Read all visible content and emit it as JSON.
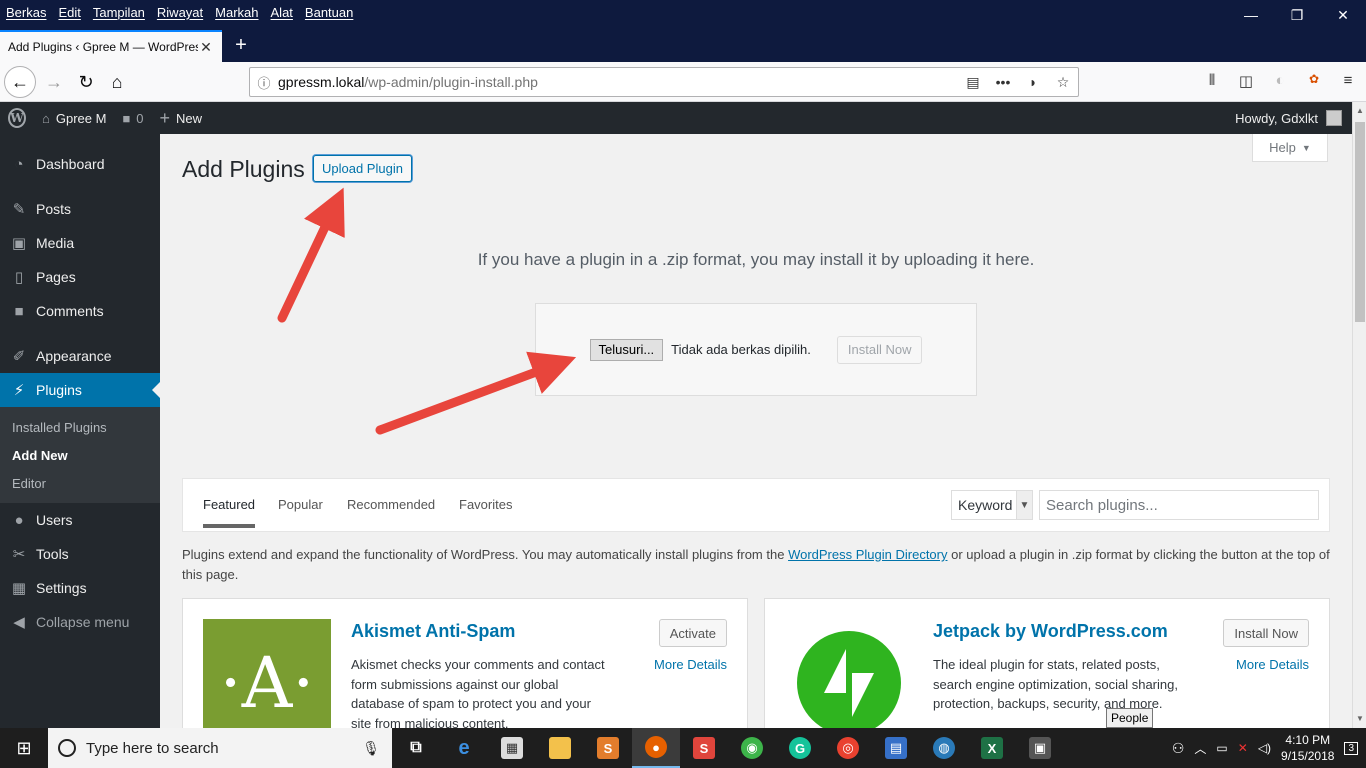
{
  "browser": {
    "menu": [
      "Berkas",
      "Edit",
      "Tampilan",
      "Riwayat",
      "Markah",
      "Alat",
      "Bantuan"
    ],
    "tab_title": "Add Plugins ‹ Gpree M — WordPres",
    "url_host": "gpressm.lokal",
    "url_path": "/wp-admin/plugin-install.php"
  },
  "adminbar": {
    "site_name": "Gpree M",
    "comments_count": "0",
    "new_label": "New",
    "howdy": "Howdy, Gdxlkt"
  },
  "sidebar": {
    "items": [
      {
        "label": "Dashboard",
        "icon": "dashboard-icon"
      },
      {
        "label": "Posts",
        "icon": "pin-icon"
      },
      {
        "label": "Media",
        "icon": "media-icon"
      },
      {
        "label": "Pages",
        "icon": "pages-icon"
      },
      {
        "label": "Comments",
        "icon": "comment-icon"
      },
      {
        "label": "Appearance",
        "icon": "brush-icon"
      },
      {
        "label": "Plugins",
        "icon": "plug-icon"
      },
      {
        "label": "Users",
        "icon": "user-icon"
      },
      {
        "label": "Tools",
        "icon": "wrench-icon"
      },
      {
        "label": "Settings",
        "icon": "sliders-icon"
      },
      {
        "label": "Collapse menu",
        "icon": "collapse-icon"
      }
    ],
    "submenu": [
      "Installed Plugins",
      "Add New",
      "Editor"
    ]
  },
  "page": {
    "help": "Help",
    "title": "Add Plugins",
    "upload_button": "Upload Plugin",
    "upload_help": "If you have a plugin in a .zip format, you may install it by uploading it here.",
    "browse_button": "Telusuri...",
    "no_file": "Tidak ada berkas dipilih.",
    "install_now": "Install Now"
  },
  "filter": {
    "tabs": [
      "Featured",
      "Popular",
      "Recommended",
      "Favorites"
    ],
    "search_type": "Keyword",
    "search_placeholder": "Search plugins..."
  },
  "description": {
    "before": "Plugins extend and expand the functionality of WordPress. You may automatically install plugins from the ",
    "link": "WordPress Plugin Directory",
    "after": " or upload a plugin in .zip format by clicking the button at the top of this page."
  },
  "cards": [
    {
      "name": "Akismet Anti-Spam",
      "desc": "Akismet checks your comments and contact form submissions against our global database of spam to protect you and your site from malicious content.",
      "button": "Activate",
      "more": "More Details"
    },
    {
      "name": "Jetpack by WordPress.com",
      "desc": "The ideal plugin for stats, related posts, search engine optimization, social sharing, protection, backups, security, and more.",
      "button": "Install Now",
      "more": "More Details"
    }
  ],
  "tooltip": "People",
  "taskbar": {
    "search_placeholder": "Type here to search",
    "time": "4:10 PM",
    "date": "9/15/2018",
    "notifications": "3"
  },
  "colors": {
    "wp_blue": "#0073aa",
    "admin_dark": "#23282d",
    "arrow_red": "#e8453c"
  }
}
